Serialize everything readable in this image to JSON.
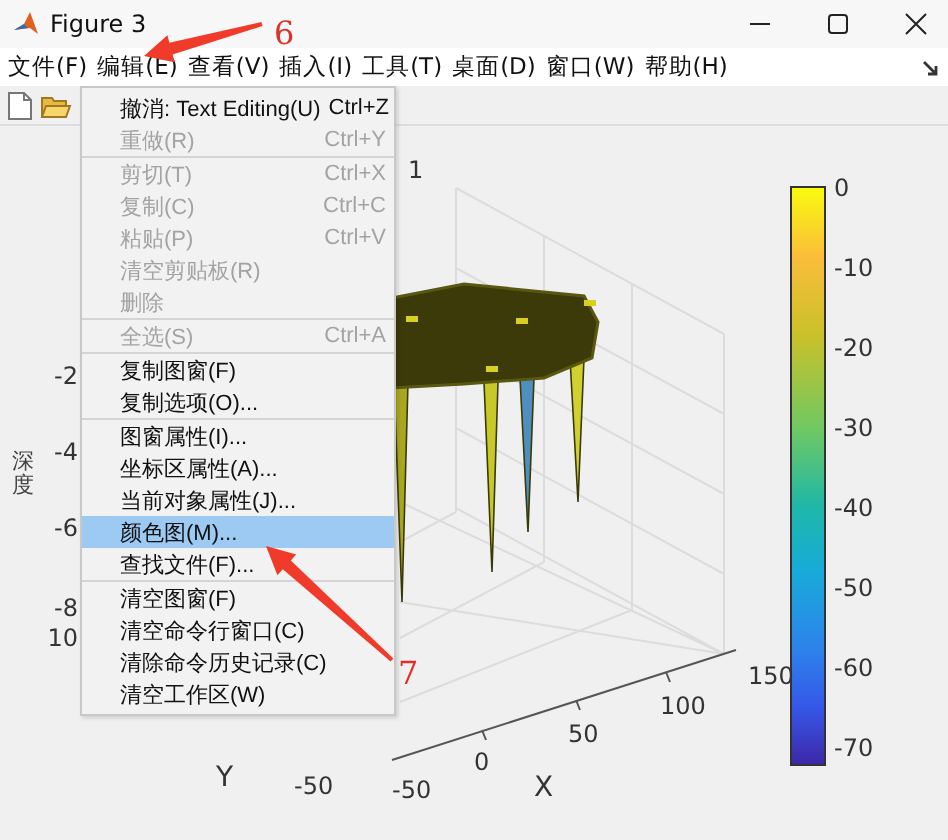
{
  "window": {
    "title": "Figure 3"
  },
  "menubar": [
    {
      "label": "文件(F)"
    },
    {
      "label": "编辑(E)"
    },
    {
      "label": "查看(V)"
    },
    {
      "label": "插入(I)"
    },
    {
      "label": "工具(T)"
    },
    {
      "label": "桌面(D)"
    },
    {
      "label": "窗口(W)"
    },
    {
      "label": "帮助(H)"
    }
  ],
  "edit_menu": {
    "sections": [
      [
        {
          "label": "撤消: Text Editing(U)",
          "shortcut": "Ctrl+Z",
          "disabled": false,
          "selected": false
        },
        {
          "label": "重做(R)",
          "shortcut": "Ctrl+Y",
          "disabled": true,
          "selected": false
        }
      ],
      [
        {
          "label": "剪切(T)",
          "shortcut": "Ctrl+X",
          "disabled": true,
          "selected": false
        },
        {
          "label": "复制(C)",
          "shortcut": "Ctrl+C",
          "disabled": true,
          "selected": false
        },
        {
          "label": "粘贴(P)",
          "shortcut": "Ctrl+V",
          "disabled": true,
          "selected": false
        },
        {
          "label": "清空剪贴板(R)",
          "disabled": true,
          "selected": false
        },
        {
          "label": "删除",
          "disabled": true,
          "selected": false
        }
      ],
      [
        {
          "label": "全选(S)",
          "shortcut": "Ctrl+A",
          "disabled": true,
          "selected": false
        }
      ],
      [
        {
          "label": "复制图窗(F)",
          "disabled": false,
          "selected": false
        },
        {
          "label": "复制选项(O)...",
          "disabled": false,
          "selected": false
        }
      ],
      [
        {
          "label": "图窗属性(I)...",
          "disabled": false,
          "selected": false
        },
        {
          "label": "坐标区属性(A)...",
          "disabled": false,
          "selected": false
        },
        {
          "label": "当前对象属性(J)...",
          "disabled": false,
          "selected": false
        },
        {
          "label": "颜色图(M)...",
          "disabled": false,
          "selected": true
        },
        {
          "label": "查找文件(F)...",
          "disabled": false,
          "selected": false
        }
      ],
      [
        {
          "label": "清空图窗(F)",
          "disabled": false,
          "selected": false
        },
        {
          "label": "清空命令行窗口(C)",
          "disabled": false,
          "selected": false
        },
        {
          "label": "清除命令历史记录(C)",
          "disabled": false,
          "selected": false
        },
        {
          "label": "清空工作区(W)",
          "disabled": false,
          "selected": false
        }
      ]
    ]
  },
  "axes": {
    "corner_label": "1",
    "zlabel": "深度",
    "z_ticks": [
      "-2",
      "-4",
      "-6",
      "-8",
      "10"
    ],
    "x_ticks": [
      "150",
      "100",
      "50",
      "0",
      "-50"
    ],
    "xlabel": "X",
    "ylabel": "Y",
    "y_ticks": [
      "-50"
    ]
  },
  "colorbar": {
    "ticks": [
      "0",
      "-10",
      "-20",
      "-30",
      "-40",
      "-50",
      "-60",
      "-70"
    ]
  },
  "annotations": [
    {
      "label": "6"
    },
    {
      "label": "7"
    }
  ]
}
